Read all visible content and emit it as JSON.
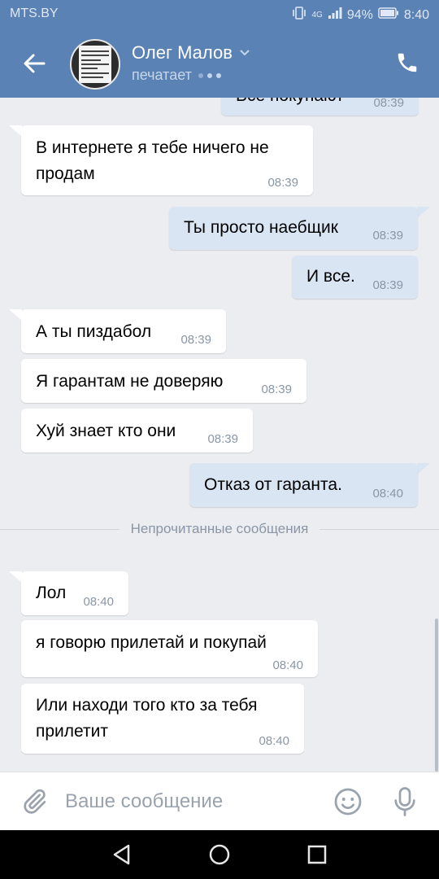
{
  "status_bar": {
    "carrier": "MTS.BY",
    "network": "4G",
    "battery": "94%",
    "time": "8:40"
  },
  "header": {
    "contact_name": "Олег Малов",
    "status": "печатает"
  },
  "messages": [
    {
      "dir": "out",
      "text": "Все покупают",
      "time": "08:39"
    },
    {
      "dir": "in",
      "text": "В интернете я тебе ничего не продам",
      "lines": [
        "В интернете я тебе ничего не",
        "продам"
      ],
      "time": "08:39"
    },
    {
      "dir": "out",
      "text": "Ты просто наебщик",
      "time": "08:39"
    },
    {
      "dir": "out",
      "text": "И все.",
      "time": "08:39"
    },
    {
      "dir": "in",
      "text": "А ты пиздабол",
      "time": "08:39"
    },
    {
      "dir": "in",
      "text": "Я гарантам не доверяю",
      "time": "08:39"
    },
    {
      "dir": "in",
      "text": "Хуй знает кто они",
      "time": "08:39"
    },
    {
      "dir": "out",
      "text": "Отказ от гаранта.",
      "time": "08:40"
    },
    {
      "dir": "in",
      "text": "Лол",
      "time": "08:40"
    },
    {
      "dir": "in",
      "text": "я говорю прилетай и покупай",
      "time": "08:40"
    },
    {
      "dir": "in",
      "text": "Или находи того кто за тебя прилетит",
      "lines": [
        "Или находи того кто за тебя",
        "прилетит"
      ],
      "time": "08:40"
    }
  ],
  "unread_divider": "Непрочитанные сообщения",
  "composer": {
    "placeholder": "Ваше сообщение"
  },
  "icons": {
    "back": "arrow-left-icon",
    "call": "phone-icon",
    "attach": "paperclip-icon",
    "emoji": "smiley-icon",
    "mic": "microphone-icon",
    "nav_back": "triangle-back-icon",
    "nav_home": "circle-home-icon",
    "nav_recent": "square-recent-icon"
  },
  "colors": {
    "header": "#5b82b5",
    "incoming_bubble": "#ffffff",
    "outgoing_bubble": "#dae5f4",
    "chat_bg": "#ebedf0"
  }
}
